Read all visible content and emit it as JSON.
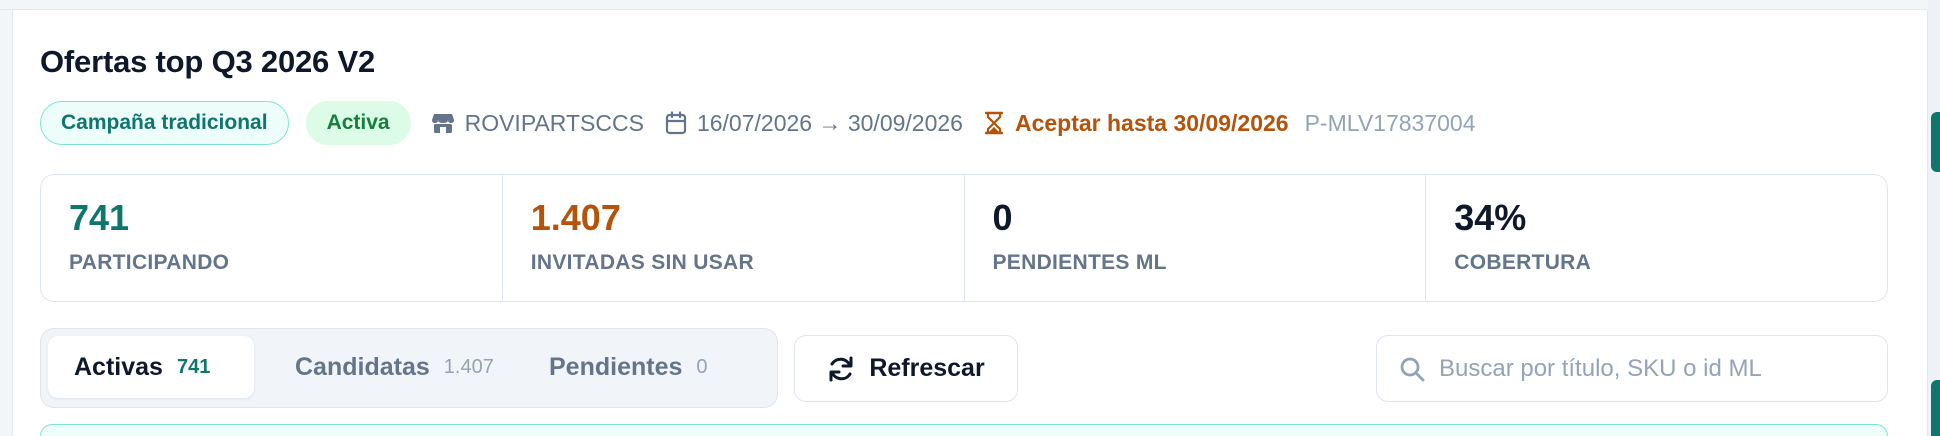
{
  "campaign": {
    "title": "Ofertas top Q3 2026 V2",
    "type_chip": "Campaña tradicional",
    "status_chip": "Activa",
    "seller": "ROVIPARTSCCS",
    "date_range": "16/07/2026 → 30/09/2026",
    "deadline": "Aceptar hasta 30/09/2026",
    "promo_id": "P-MLV17837004"
  },
  "stats": [
    {
      "value": "741",
      "label": "PARTICIPANDO",
      "color": "#0f766e"
    },
    {
      "value": "1.407",
      "label": "INVITADAS SIN USAR",
      "color": "#b45309"
    },
    {
      "value": "0",
      "label": "PENDIENTES ML",
      "color": "#0f172a"
    },
    {
      "value": "34%",
      "label": "COBERTURA",
      "color": "#0f172a"
    }
  ],
  "tabs": [
    {
      "label": "Activas",
      "count": "741",
      "active": true
    },
    {
      "label": "Candidatas",
      "count": "1.407",
      "active": false
    },
    {
      "label": "Pendientes",
      "count": "0",
      "active": false
    }
  ],
  "toolbar": {
    "refresh_label": "Refrescar",
    "search_placeholder": "Buscar por título, SKU o id ML",
    "search_value": ""
  },
  "icons": {
    "seller": "store-icon",
    "dates": "calendar-icon",
    "deadline": "hourglass-icon",
    "refresh": "refresh-icon",
    "search": "search-icon"
  },
  "colors": {
    "accent": "#0f766e",
    "warning": "#b45309",
    "success": "#15803d",
    "muted": "#64748b"
  }
}
